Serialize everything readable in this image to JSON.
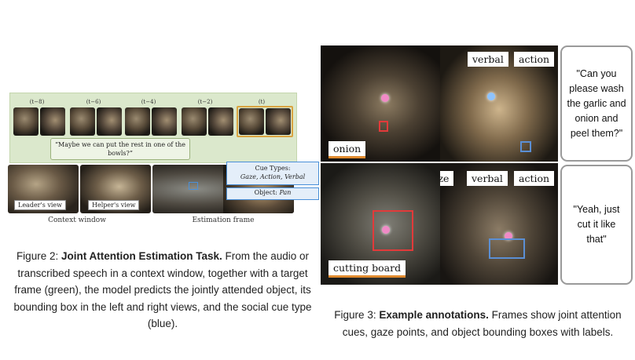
{
  "figure2": {
    "timeline_labels": [
      "(t−8)",
      "(t−6)",
      "(t−4)",
      "(t−2)",
      "(t)"
    ],
    "speech_text": "“Maybe we can put the rest in one of the bowls?”",
    "leader_view_label": "Leader's view",
    "helper_view_label": "Helper's view",
    "cue_types_heading": "Cue Types:",
    "cue_types_values": "Gaze, Action, Verbal",
    "object_label": "Object:",
    "object_value": "Pan",
    "context_window_caption": "Context window",
    "estimation_frame_caption": "Estimation frame",
    "caption_prefix": "Figure 2: ",
    "caption_title": "Joint Attention Estimation Task.",
    "caption_body": " From the audio or transcribed speech in a context window, together with a target frame (green), the model predicts the jointly attended object, its bounding box in the left and right views, and the social cue type (blue)."
  },
  "figure3": {
    "row1_tags": [
      "verbal",
      "action"
    ],
    "row1_object": "onion",
    "row1_quote": "\"Can you please wash the garlic and onion and peel them?\"",
    "row2_tags": [
      "gaze",
      "verbal",
      "action"
    ],
    "row2_object": "cutting board",
    "row2_quote": "\"Yeah, just cut it like that\"",
    "caption_prefix": "Figure 3: ",
    "caption_title": "Example annotations.",
    "caption_body": " Frames show joint attention cues, gaze points, and object bounding boxes with labels."
  }
}
